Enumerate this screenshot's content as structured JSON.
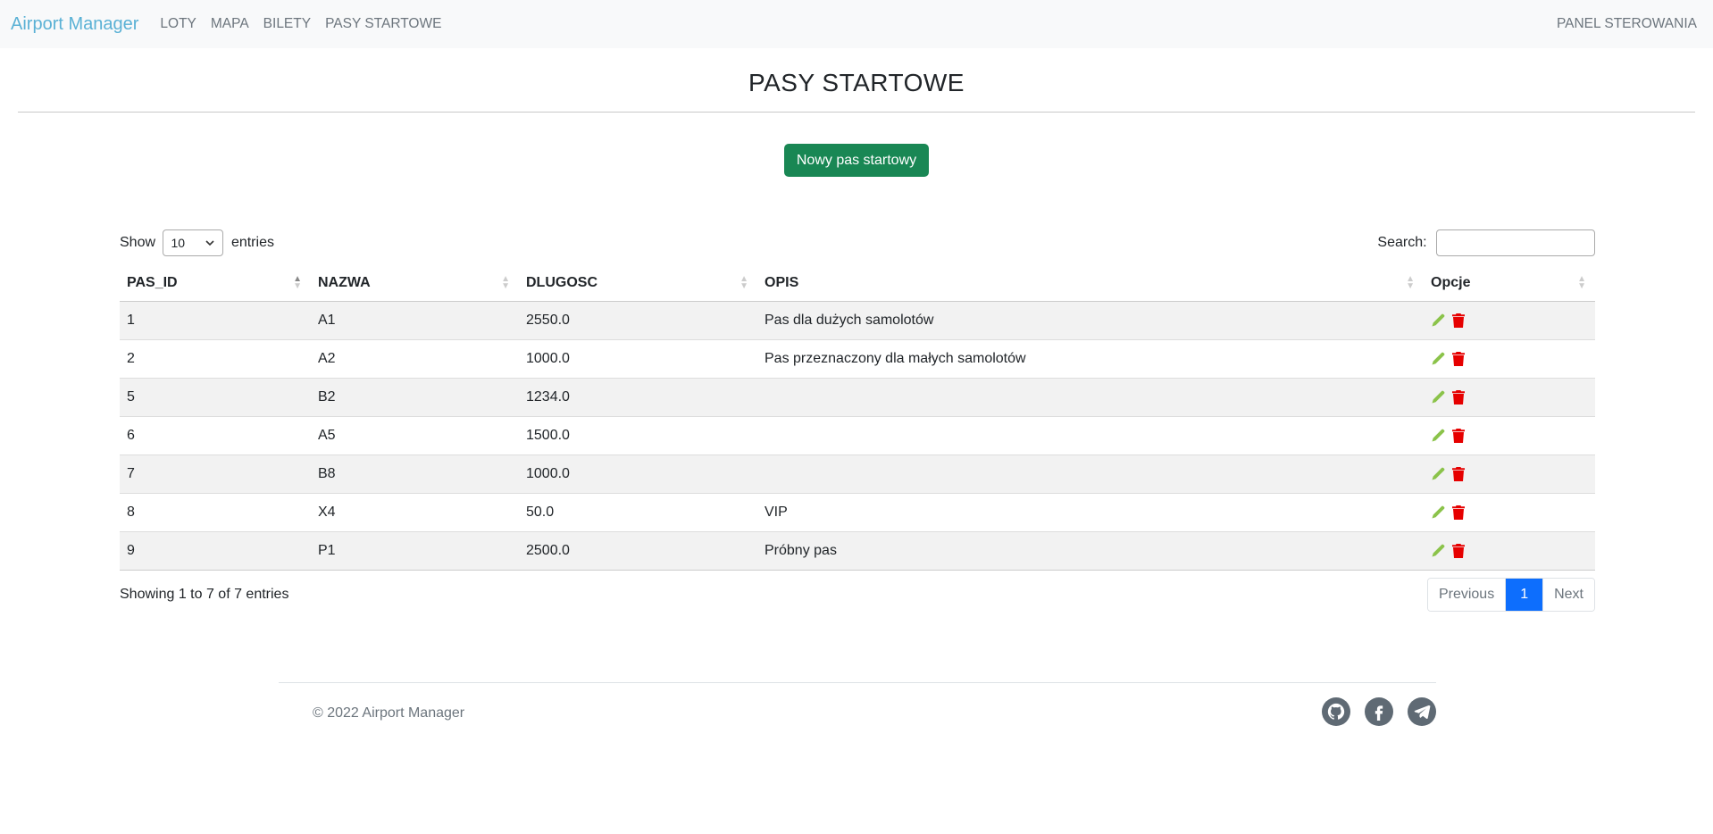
{
  "nav": {
    "brand": "Airport Manager",
    "links": [
      "LOTY",
      "MAPA",
      "BILETY",
      "PASY STARTOWE"
    ],
    "right": "PANEL STEROWANIA"
  },
  "page": {
    "title": "PASY STARTOWE",
    "new_button": "Nowy pas startowy"
  },
  "table_controls": {
    "show_label": "Show",
    "entries_value": "10",
    "entries_label": "entries",
    "search_label": "Search:",
    "search_value": ""
  },
  "table": {
    "headers": [
      "PAS_ID",
      "NAZWA",
      "DLUGOSC",
      "OPIS",
      "Opcje"
    ],
    "rows": [
      [
        "1",
        "A1",
        "2550.0",
        "Pas dla dużych samolotów"
      ],
      [
        "2",
        "A2",
        "1000.0",
        "Pas przeznaczony dla małych samolotów"
      ],
      [
        "5",
        "B2",
        "1234.0",
        ""
      ],
      [
        "6",
        "A5",
        "1500.0",
        ""
      ],
      [
        "7",
        "B8",
        "1000.0",
        ""
      ],
      [
        "8",
        "X4",
        "50.0",
        "VIP"
      ],
      [
        "9",
        "P1",
        "2500.0",
        "Próbny pas"
      ]
    ]
  },
  "pagination": {
    "info": "Showing 1 to 7 of 7 entries",
    "previous": "Previous",
    "current": "1",
    "next": "Next"
  },
  "footer": {
    "copyright": "© 2022 Airport Manager",
    "socials": [
      "github-icon",
      "facebook-icon",
      "telegram-icon"
    ]
  },
  "colors": {
    "brand": "#5ab1d5",
    "primary_button": "#198754",
    "edit_icon": "#8bc34a",
    "delete_icon": "#e60000",
    "active_page": "#0d6efd"
  }
}
